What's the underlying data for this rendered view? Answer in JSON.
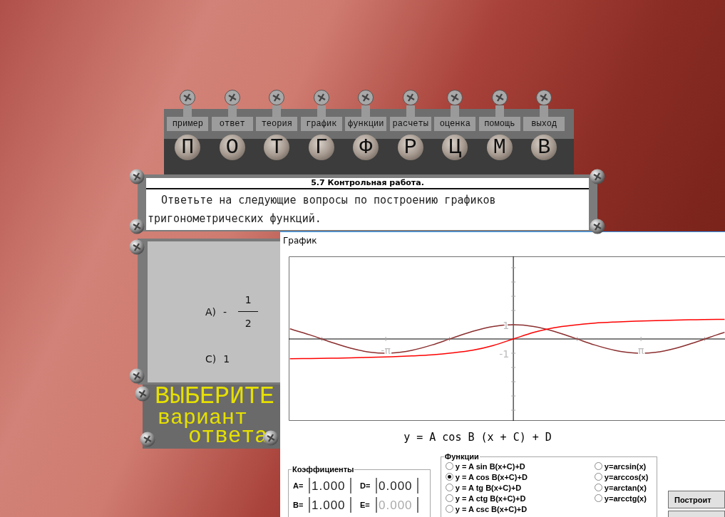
{
  "toolbar": {
    "items": [
      {
        "label": "пример",
        "letter": "П"
      },
      {
        "label": "ответ",
        "letter": "О"
      },
      {
        "label": "теория",
        "letter": "Т"
      },
      {
        "label": "график",
        "letter": "Г"
      },
      {
        "label": "функции",
        "letter": "Ф"
      },
      {
        "label": "расчеты",
        "letter": "Р"
      },
      {
        "label": "оценка",
        "letter": "Ц"
      },
      {
        "label": "помощь",
        "letter": "М"
      },
      {
        "label": "выход",
        "letter": "В"
      }
    ]
  },
  "question": {
    "title": "5.7 Контрольная работа.",
    "text": "Ответьте на следующие вопросы по построению графиков тригонометрических функций."
  },
  "answers": [
    {
      "kind": "fraction",
      "label": "A)",
      "sign": "-",
      "numerator": "1",
      "denominator": "2"
    },
    {
      "kind": "plain",
      "label": "C)",
      "value": "1"
    }
  ],
  "prompt": [
    "ВЫБЕРИТЕ",
    "вариант",
    "ответа"
  ],
  "graph_window": {
    "title": "График",
    "chart_data": {
      "type": "line",
      "x": [
        -5.5,
        -5,
        -4.5,
        -4,
        -3.5,
        -3,
        -2.5,
        -2,
        -1.5,
        -1,
        -0.5,
        0,
        0.5,
        1,
        1.5,
        2,
        2.5,
        3,
        3.5,
        4,
        4.5,
        5,
        5.2
      ],
      "series": [
        {
          "color": "#8b2e2e",
          "values": [
            0.71,
            0.28,
            -0.21,
            -0.65,
            -0.94,
            -0.99,
            -0.8,
            -0.42,
            0.07,
            0.54,
            0.88,
            1,
            0.88,
            0.54,
            0.07,
            -0.42,
            -0.8,
            -0.99,
            -0.94,
            -0.65,
            -0.21,
            0.28,
            0.47
          ]
        },
        {
          "color": "#ff0000",
          "values": [
            -1.39,
            -1.37,
            -1.35,
            -1.33,
            -1.29,
            -1.25,
            -1.19,
            -1.11,
            -0.98,
            -0.79,
            -0.46,
            0,
            0.46,
            0.79,
            0.98,
            1.11,
            1.19,
            1.25,
            1.29,
            1.33,
            1.35,
            1.37,
            1.38
          ]
        }
      ],
      "xlim": [
        -5.53,
        5.21
      ],
      "ylim": [
        -5.75,
        5.8
      ],
      "xticks": [
        {
          "value": -3.1416,
          "label": "-π"
        },
        {
          "value": 3.1416,
          "label": "π"
        }
      ],
      "yticks": [
        {
          "value": 1,
          "label": "1"
        },
        {
          "value": -1,
          "label": "-1"
        }
      ]
    },
    "formula": "y = A cos B (x + C) + D",
    "coefficients": {
      "title": "Коэффициенты",
      "fields": [
        {
          "label": "A=",
          "value": "1.000",
          "disabled": false
        },
        {
          "label": "D=",
          "value": "0.000",
          "disabled": false
        },
        {
          "label": "B=",
          "value": "1.000",
          "disabled": false
        },
        {
          "label": "E=",
          "value": "0.000",
          "disabled": true
        }
      ]
    },
    "functions": {
      "title": "Функции",
      "options": [
        {
          "label": "y = A sin B(x+C)+D",
          "selected": false
        },
        {
          "label": "y = A cos B(x+C)+D",
          "selected": true
        },
        {
          "label": "y = A tg B(x+C)+D",
          "selected": false
        },
        {
          "label": "y = A ctg B(x+C)+D",
          "selected": false
        },
        {
          "label": "y = A csc B(x+C)+D",
          "selected": false
        },
        {
          "label": "y=arcsin(x)",
          "selected": false
        },
        {
          "label": "y=arccos(x)",
          "selected": false
        },
        {
          "label": "y=arctan(x)",
          "selected": false
        },
        {
          "label": "y=arcctg(x)",
          "selected": false
        }
      ]
    },
    "buttons": [
      "Построит"
    ]
  }
}
